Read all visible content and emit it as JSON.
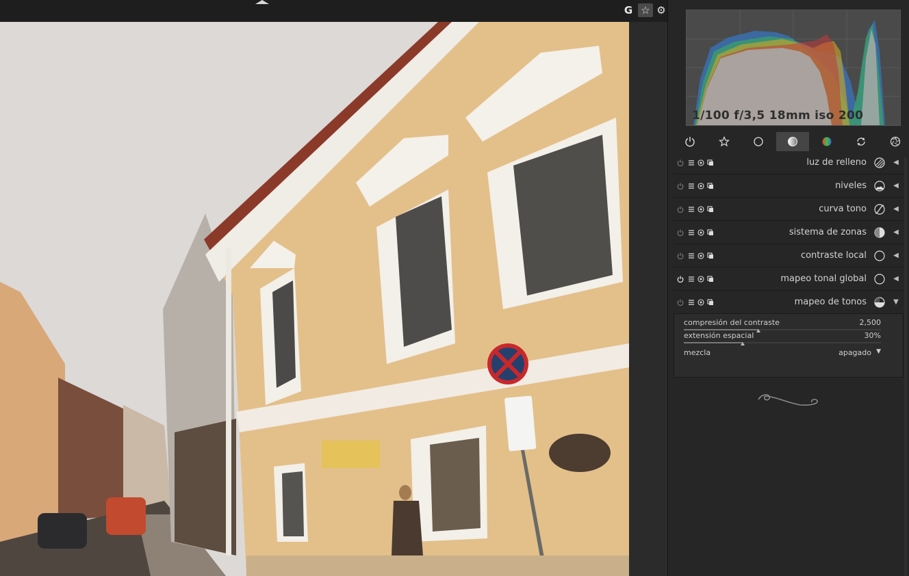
{
  "topbar": {
    "g_label": "G",
    "star_label": "☆",
    "gear_label": "⚙"
  },
  "histogram": {
    "exif": "1/100 f/3,5 18mm iso 200"
  },
  "group_tabs": [
    {
      "icon": "power-icon"
    },
    {
      "icon": "star-icon"
    },
    {
      "icon": "circle-icon"
    },
    {
      "icon": "tone-circle-icon",
      "active": true
    },
    {
      "icon": "color-circle-icon"
    },
    {
      "icon": "rotate-icon"
    },
    {
      "icon": "aperture-icon"
    }
  ],
  "modules": [
    {
      "name": "luz de relleno",
      "icon": "fill-light-icon",
      "arrow": "◀",
      "enabled": false
    },
    {
      "name": "niveles",
      "icon": "levels-icon",
      "arrow": "◀",
      "enabled": false
    },
    {
      "name": "curva tono",
      "icon": "tone-curve-icon",
      "arrow": "◀",
      "enabled": false
    },
    {
      "name": "sistema de zonas",
      "icon": "zone-system-icon",
      "arrow": "◀",
      "enabled": false
    },
    {
      "name": "contraste local",
      "icon": "local-contrast-icon",
      "arrow": "◀",
      "enabled": false
    },
    {
      "name": "mapeo tonal global",
      "icon": "global-tonemap-icon",
      "arrow": "◀",
      "enabled": true
    },
    {
      "name": "mapeo de tonos",
      "icon": "tonemap-icon",
      "arrow": "▼",
      "enabled": false
    }
  ],
  "tonemap": {
    "contrast": {
      "label": "compresión del contraste",
      "value": "2,500",
      "position": 0.38
    },
    "spatial": {
      "label": "extensión espacial",
      "value": "30%",
      "position": 0.3
    },
    "blend": {
      "label": "mezcla",
      "value": "apagado",
      "arrow": "▼"
    }
  },
  "colors": {
    "background": "#262626",
    "histogram_bg": "#444444",
    "active_tab": "#454545"
  }
}
